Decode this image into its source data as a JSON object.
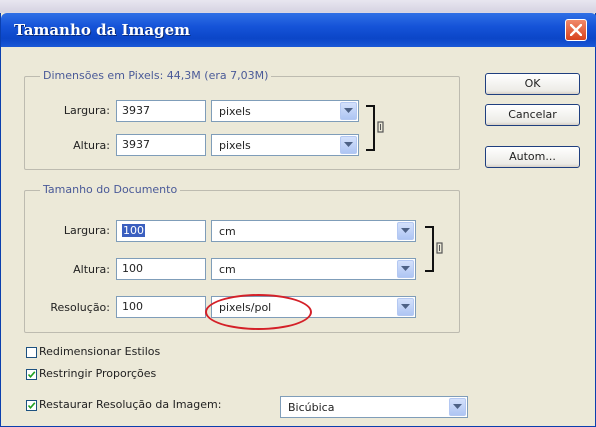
{
  "window": {
    "title": "Tamanho da Imagem"
  },
  "pixel_dimensions": {
    "title": "Dimensões em Pixels:  44,3M (era 7,03M)",
    "width": {
      "label": "Largura:",
      "value": "3937",
      "unit": "pixels"
    },
    "height": {
      "label": "Altura:",
      "value": "3937",
      "unit": "pixels"
    }
  },
  "document_size": {
    "title": "Tamanho do Documento",
    "width": {
      "label": "Largura:",
      "value": "100",
      "unit": "cm"
    },
    "height": {
      "label": "Altura:",
      "value": "100",
      "unit": "cm"
    },
    "resolution": {
      "label": "Resolução:",
      "value": "100",
      "unit": "pixels/pol"
    }
  },
  "buttons": {
    "ok": "OK",
    "cancel": "Cancelar",
    "auto": "Autom..."
  },
  "options": {
    "scale_styles": {
      "label": "Redimensionar Estilos",
      "checked": false
    },
    "constrain_proportions": {
      "label": "Restringir Proporções",
      "checked": true
    },
    "resample": {
      "label": "Restaurar Resolução da Imagem:",
      "checked": true,
      "method": "Bicúbica"
    }
  },
  "annotation": {
    "color": "#d42028"
  }
}
